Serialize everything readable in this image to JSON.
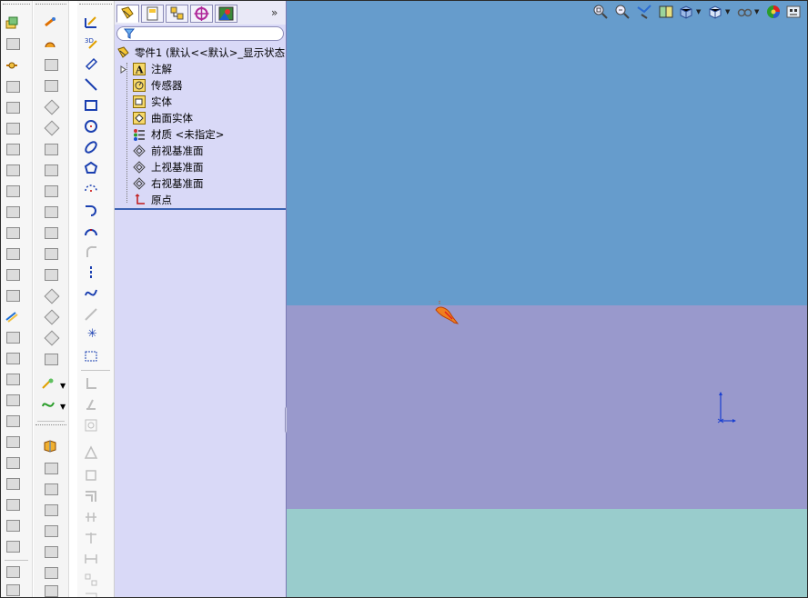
{
  "feature_tree": {
    "part": "零件1 (默认<<默认>_显示状态",
    "items": [
      {
        "label": "注解",
        "icon": "annotation-icon"
      },
      {
        "label": "传感器",
        "icon": "sensor-icon"
      },
      {
        "label": "实体",
        "icon": "solid-bodies-icon"
      },
      {
        "label": "曲面实体",
        "icon": "surface-bodies-icon"
      },
      {
        "label": "材质 <未指定>",
        "icon": "material-icon"
      },
      {
        "label": "前视基准面",
        "icon": "plane-icon"
      },
      {
        "label": "上视基准面",
        "icon": "plane-icon"
      },
      {
        "label": "右视基准面",
        "icon": "plane-icon"
      },
      {
        "label": "原点",
        "icon": "origin-icon"
      }
    ],
    "tabs": [
      "feature-manager-tab",
      "property-manager-tab",
      "configuration-manager-tab",
      "dimxpert-tab",
      "display-manager-tab"
    ],
    "more": "»"
  },
  "colors": {
    "viewport_top": "#669ccc",
    "viewport_middle": "#9999cc",
    "viewport_bottom": "#99cccc",
    "tree_background": "#d9d9f7",
    "accent": "#3b62b3"
  },
  "heads_up_toolbar": [
    "zoom-to-fit-icon",
    "zoom-to-area-icon",
    "previous-view-icon",
    "section-view-icon",
    "view-orientation-icon",
    "display-style-icon",
    "hide-show-items-icon",
    "edit-appearance-icon",
    "apply-scene-icon"
  ]
}
